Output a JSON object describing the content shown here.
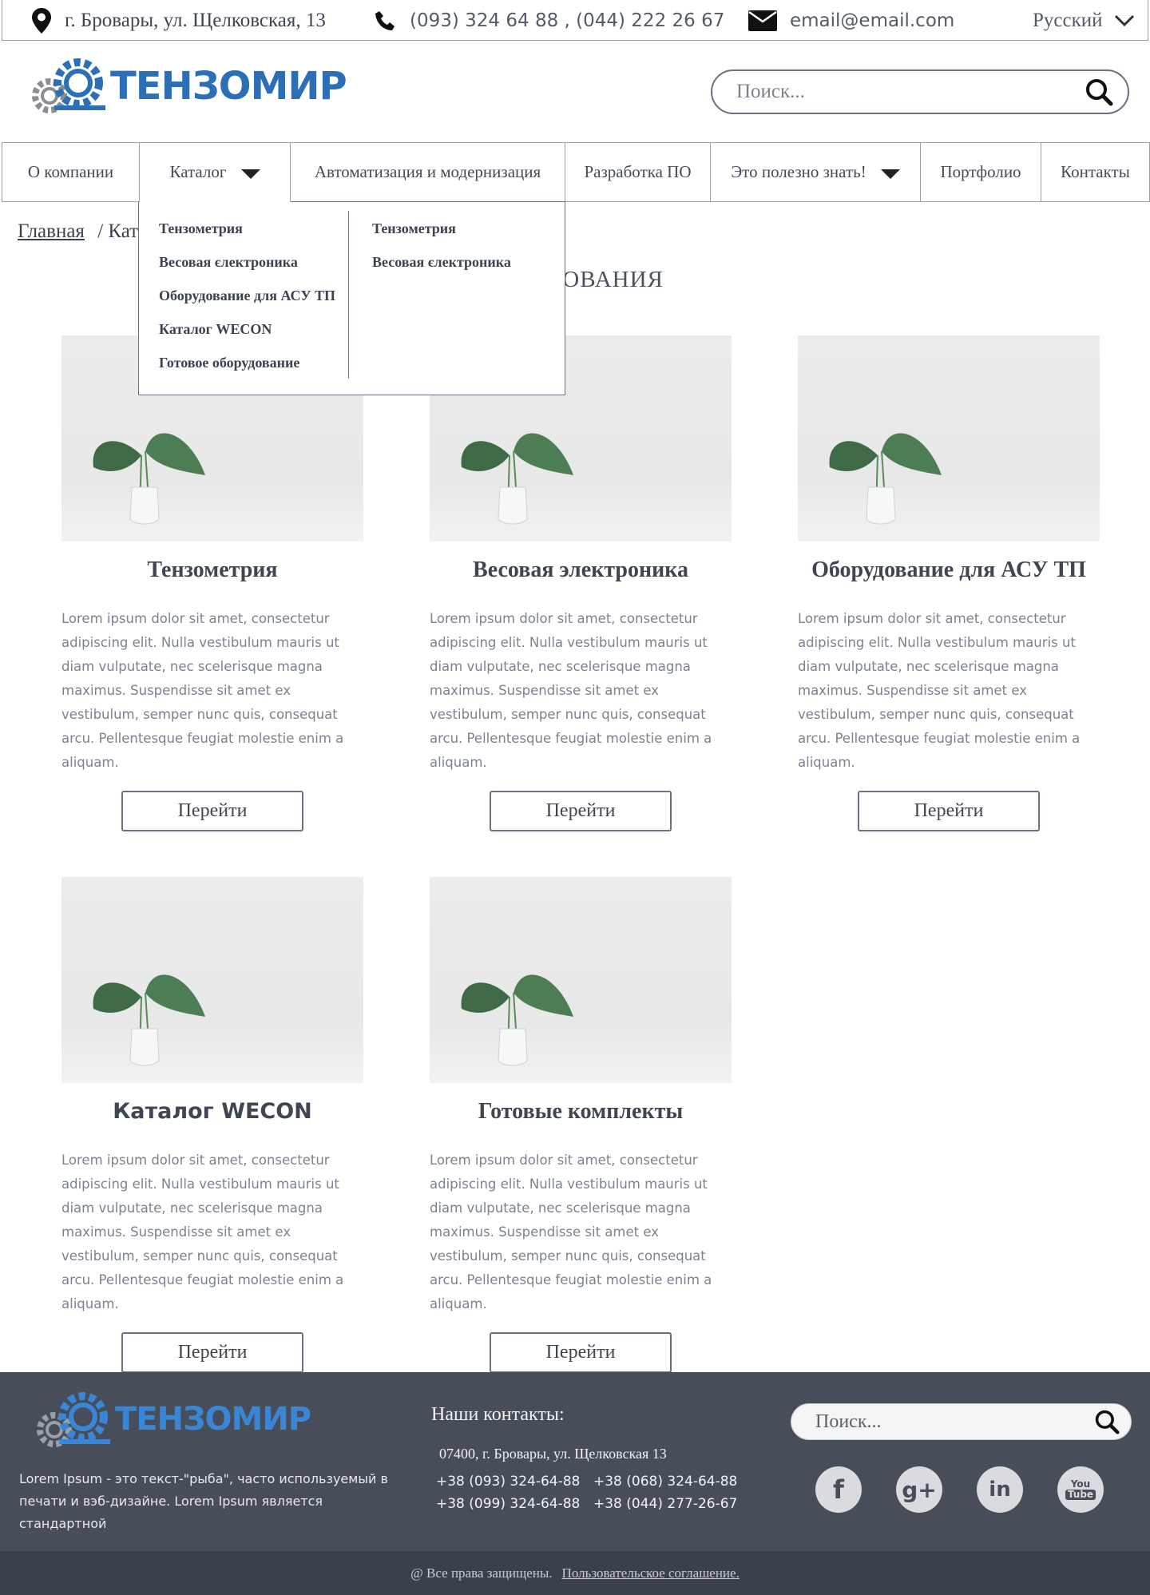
{
  "topbar": {
    "address": "г. Бровары, ул. Щелковская, 13",
    "phones": "(093) 324 64 88 , (044) 222 26 67",
    "email": "email@email.com",
    "language": "Русский"
  },
  "header": {
    "logo_text": "ТЕНЗОМИР",
    "search_placeholder": "Поиск..."
  },
  "nav": {
    "items": [
      {
        "label": "О компании"
      },
      {
        "label": "Каталог"
      },
      {
        "label": "Автоматизация и модернизация"
      },
      {
        "label": "Разработка ПО"
      },
      {
        "label": "Это полезно знать!"
      },
      {
        "label": "Портфолио"
      },
      {
        "label": "Контакты"
      }
    ]
  },
  "dropdown": {
    "col1": [
      "Тензометрия",
      "Весовая єлектроника",
      "Оборудование для АСУ ТП",
      "Каталог WECON",
      "Готовое оборудование"
    ],
    "col2": [
      "Тензометрия",
      "Весовая єлектроника"
    ]
  },
  "breadcrumb": {
    "home": "Главная",
    "separator": "/",
    "current": "Кат"
  },
  "page_title": "БОРУДОВАНИЯ",
  "cards": [
    {
      "title": "Тензометрия",
      "text": "Lorem ipsum dolor sit amet, consectetur adipiscing elit. Nulla vestibulum mauris ut diam vulputate, nec scelerisque magna maximus. Suspendisse sit amet ex vestibulum, semper nunc quis, consequat arcu. Pellentesque feugiat molestie enim a aliquam.",
      "button": "Перейти"
    },
    {
      "title": "Весовая электроника",
      "text": "Lorem ipsum dolor sit amet, consectetur adipiscing elit. Nulla vestibulum mauris ut diam vulputate, nec scelerisque magna maximus. Suspendisse sit amet ex vestibulum, semper nunc quis, consequat arcu. Pellentesque feugiat molestie enim a aliquam.",
      "button": "Перейти"
    },
    {
      "title": "Оборудование для АСУ ТП",
      "text": "Lorem ipsum dolor sit amet, consectetur adipiscing elit. Nulla vestibulum mauris ut diam vulputate, nec scelerisque magna maximus. Suspendisse sit amet ex vestibulum, semper nunc quis, consequat arcu. Pellentesque feugiat molestie enim a aliquam.",
      "button": "Перейти"
    },
    {
      "title": "Каталог WECON",
      "text": "Lorem ipsum dolor sit amet, consectetur adipiscing elit. Nulla vestibulum mauris ut diam vulputate, nec scelerisque magna maximus. Suspendisse sit amet ex vestibulum, semper nunc quis, consequat arcu. Pellentesque feugiat molestie enim a aliquam.",
      "button": "Перейти"
    },
    {
      "title": "Готовые комплекты",
      "text": "Lorem ipsum dolor sit amet, consectetur adipiscing elit. Nulla vestibulum mauris ut diam vulputate, nec scelerisque magna maximus. Suspendisse sit amet ex vestibulum, semper nunc quis, consequat arcu. Pellentesque feugiat molestie enim a aliquam.",
      "button": "Перейти"
    }
  ],
  "footer": {
    "logo_text": "ТЕНЗОМИР",
    "description": "Lorem Ipsum - это текст-\"рыба\", часто используемый в печати и вэб-дизайне. Lorem Ipsum является стандартной",
    "contacts_title": "Наши контакты:",
    "address": "07400, г. Бровары, ул. Щелковская 13",
    "phones": [
      "+38 (093) 324-64-88",
      "+38 (068) 324-64-88",
      "+38 (099) 324-64-88",
      "+38 (044) 277-26-67"
    ],
    "search_placeholder": "Поиск...",
    "social": [
      "facebook-icon",
      "google-plus-icon",
      "linkedin-icon",
      "youtube-icon"
    ],
    "social_labels": {
      "facebook": "f",
      "google_plus": "g+",
      "linkedin": "in",
      "youtube_top": "You",
      "youtube_bottom": "Tube"
    },
    "copyright": "@ Все права защищены.",
    "agreement": "Пользовательское соглашение."
  },
  "colors": {
    "brand_blue": "#2c6fb5",
    "footer_bg": "#474e5a",
    "footer_bottom_bg": "#3b414c",
    "text_gray": "#7b8290"
  }
}
